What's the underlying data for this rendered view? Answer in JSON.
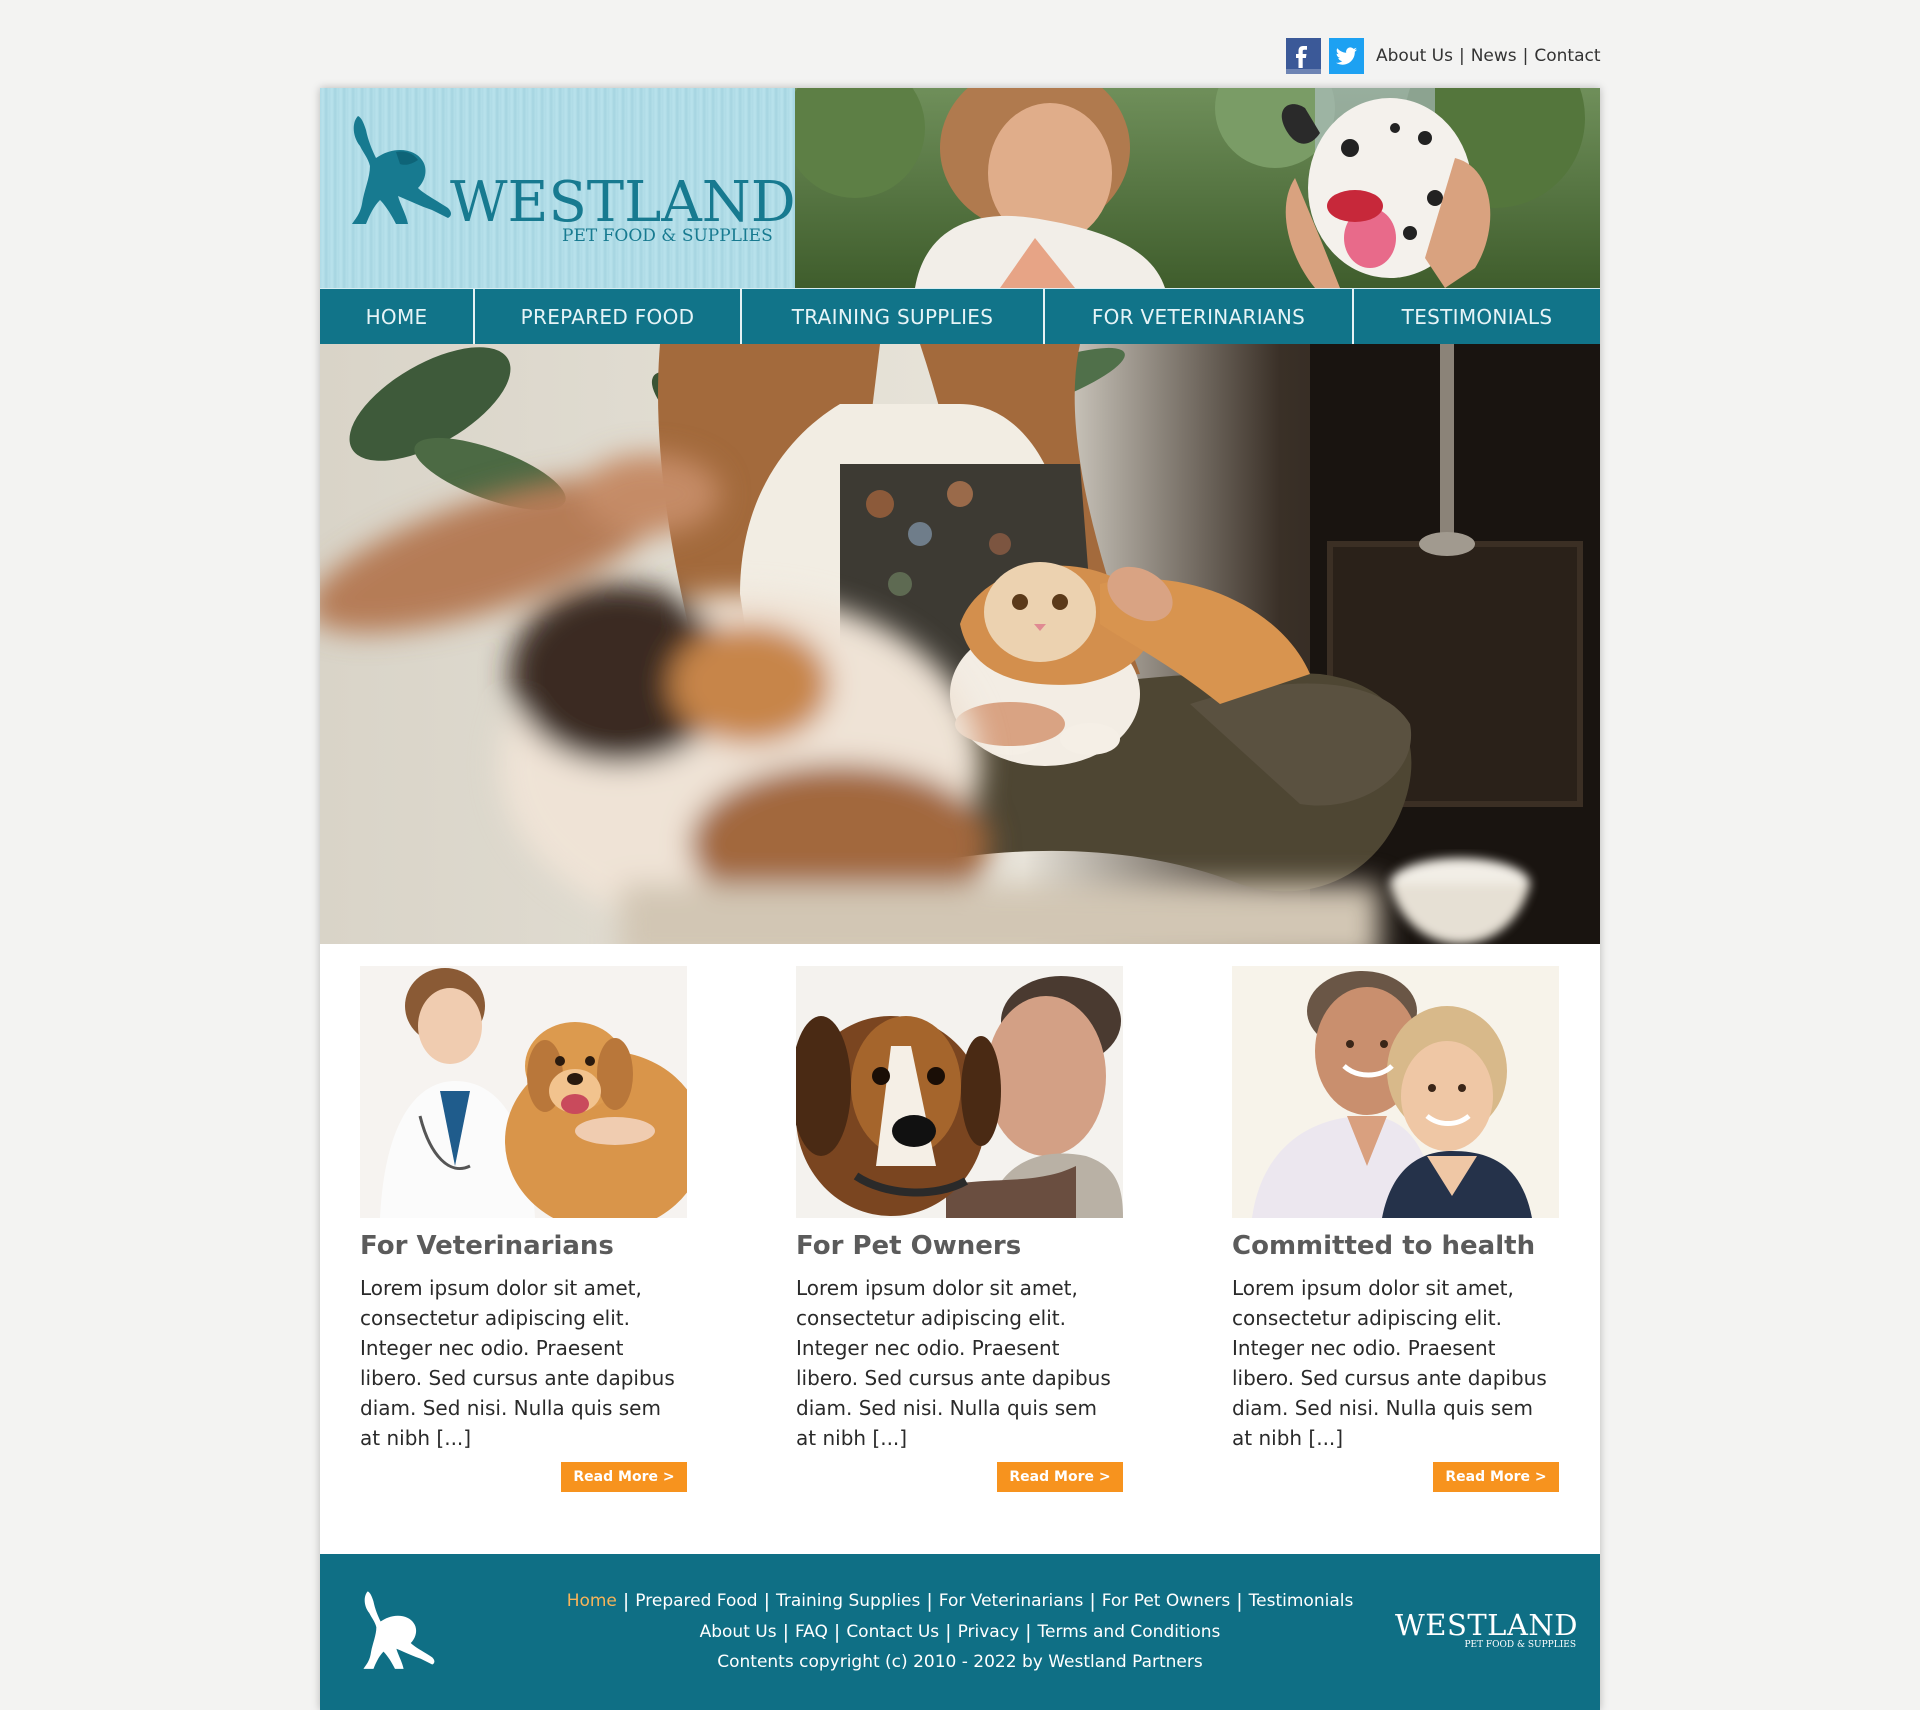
{
  "topbar": {
    "social": [
      {
        "name": "facebook-icon",
        "glyph": "f"
      },
      {
        "name": "twitter-icon",
        "glyph": "t"
      }
    ],
    "links": [
      "About Us",
      "News",
      "Contact"
    ],
    "separator": "|"
  },
  "brand": {
    "name": "WESTLAND",
    "tagline": "PET FOOD & SUPPLIES",
    "color": "#177a90"
  },
  "nav": {
    "items": [
      "HOME",
      "PREPARED FOOD",
      "TRAINING SUPPLIES",
      "FOR VETERINARIANS",
      "TESTIMONIALS"
    ],
    "background": "#117489"
  },
  "cards": [
    {
      "title": "For Veterinarians",
      "text": "Lorem ipsum dolor sit amet, consectetur adipiscing elit. Integer nec odio. Praesent libero. Sed cursus ante dapibus diam. Sed nisi. Nulla quis sem at nibh [...]",
      "button": "Read More >"
    },
    {
      "title": "For Pet Owners",
      "text": "Lorem ipsum dolor sit amet, consectetur adipiscing elit. Integer nec odio. Praesent libero. Sed cursus ante dapibus diam. Sed nisi. Nulla quis sem at nibh [...]",
      "button": "Read More >"
    },
    {
      "title": "Committed to health",
      "text": "Lorem ipsum dolor sit amet, consectetur adipiscing elit. Integer nec odio. Praesent libero. Sed cursus ante dapibus diam. Sed nisi. Nulla quis sem at nibh [...]",
      "button": "Read More >"
    }
  ],
  "footer": {
    "row1": [
      "Home",
      "Prepared Food",
      "Training Supplies",
      "For Veterinarians",
      "For Pet Owners",
      "Testimonials"
    ],
    "row2": [
      "About Us",
      "FAQ",
      "Contact Us",
      "Privacy",
      "Terms and Conditions"
    ],
    "separator": "|",
    "copyright": "Contents copyright (c) 2010 - 2022 by Westland Partners",
    "active_color": "#f8b45a",
    "logo_word": "WESTLAND",
    "logo_sub": "PET FOOD & SUPPLIES"
  }
}
